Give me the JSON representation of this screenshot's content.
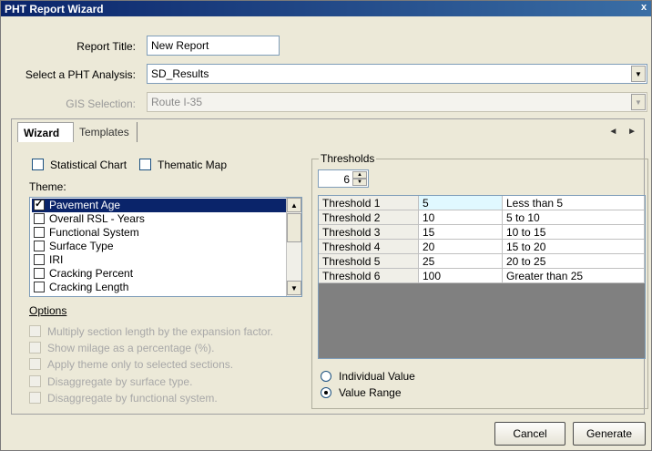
{
  "window": {
    "title": "PHT Report Wizard",
    "close_glyph": "x"
  },
  "form": {
    "report_title_label": "Report Title:",
    "report_title_value": "New Report",
    "analysis_label": "Select a PHT Analysis:",
    "analysis_value": "SD_Results",
    "gis_label": "GIS Selection:",
    "gis_value": "Route I-35"
  },
  "tabs": [
    {
      "label": "Wizard",
      "active": true
    },
    {
      "label": "Templates",
      "active": false
    }
  ],
  "tab_nav": "◄ ►",
  "chart_options": {
    "statistical_chart_label": "Statistical Chart",
    "statistical_chart_checked": false,
    "thematic_map_label": "Thematic Map",
    "thematic_map_checked": false
  },
  "theme": {
    "label": "Theme:",
    "items": [
      {
        "label": "Pavement Age",
        "checked": true,
        "selected": true
      },
      {
        "label": "Overall RSL - Years",
        "checked": false,
        "selected": false
      },
      {
        "label": "Functional System",
        "checked": false,
        "selected": false
      },
      {
        "label": "Surface Type",
        "checked": false,
        "selected": false
      },
      {
        "label": "IRI",
        "checked": false,
        "selected": false
      },
      {
        "label": "Cracking Percent",
        "checked": false,
        "selected": false
      },
      {
        "label": "Cracking Length",
        "checked": false,
        "selected": false
      }
    ]
  },
  "options": {
    "title": "Options",
    "items": [
      "Multiply section length by the expansion factor.",
      "Show milage as a percentage (%).",
      "Apply theme only to selected sections.",
      "Disaggregate by surface type.",
      "Disaggregate by functional system."
    ]
  },
  "thresholds": {
    "title": "Thresholds",
    "count": "6",
    "rows": [
      {
        "name": "Threshold 1",
        "value": "5",
        "range": "Less than 5"
      },
      {
        "name": "Threshold 2",
        "value": "10",
        "range": "5 to 10"
      },
      {
        "name": "Threshold 3",
        "value": "15",
        "range": "10 to 15"
      },
      {
        "name": "Threshold 4",
        "value": "20",
        "range": "15 to 20"
      },
      {
        "name": "Threshold 5",
        "value": "25",
        "range": "20 to 25"
      },
      {
        "name": "Threshold 6",
        "value": "100",
        "range": "Greater than 25"
      }
    ],
    "mode_individual": "Individual Value",
    "mode_range": "Value Range",
    "selected_mode": "range"
  },
  "buttons": {
    "cancel": "Cancel",
    "generate": "Generate"
  }
}
